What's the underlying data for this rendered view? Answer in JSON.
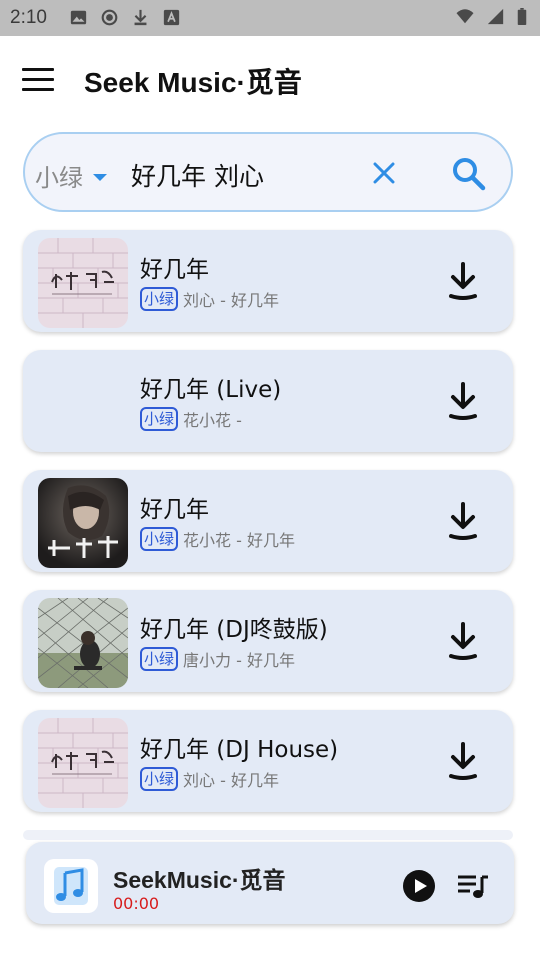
{
  "status_bar": {
    "time": "2:10",
    "left_icons": [
      "image-icon",
      "record-icon",
      "download-icon",
      "a-icon"
    ],
    "right_icons": [
      "wifi-icon",
      "signal-icon",
      "battery-icon"
    ]
  },
  "app_bar": {
    "menu_icon": "menu-icon",
    "title": "Seek Music·觅音"
  },
  "search": {
    "source": "小绿",
    "query": "好几年 刘心",
    "clear_icon": "close-icon",
    "search_icon": "search-icon"
  },
  "results": [
    {
      "title": "好几年",
      "source": "小绿",
      "subtitle": "刘心 - 好几年",
      "cover": "cover-pink-brick"
    },
    {
      "title": "好几年 (Live)",
      "source": "小绿",
      "subtitle": "花小花 -",
      "cover": "none"
    },
    {
      "title": "好几年",
      "source": "小绿",
      "subtitle": "花小花 - 好几年",
      "cover": "cover-dark-portrait"
    },
    {
      "title": "好几年 (DJ咚鼓版)",
      "source": "小绿",
      "subtitle": "唐小力 - 好几年",
      "cover": "cover-fence-photo"
    },
    {
      "title": "好几年 (DJ House)",
      "source": "小绿",
      "subtitle": "刘心 - 好几年",
      "cover": "cover-pink-brick"
    }
  ],
  "player": {
    "title": "SeekMusic·觅音",
    "time": "00:00",
    "play_icon": "play-icon",
    "queue_icon": "playlist-icon"
  },
  "colors": {
    "accent": "#2f8de4",
    "card_bg": "#e3eaf6",
    "badge": "#2f5bd6",
    "time_red": "#d71c1c"
  }
}
